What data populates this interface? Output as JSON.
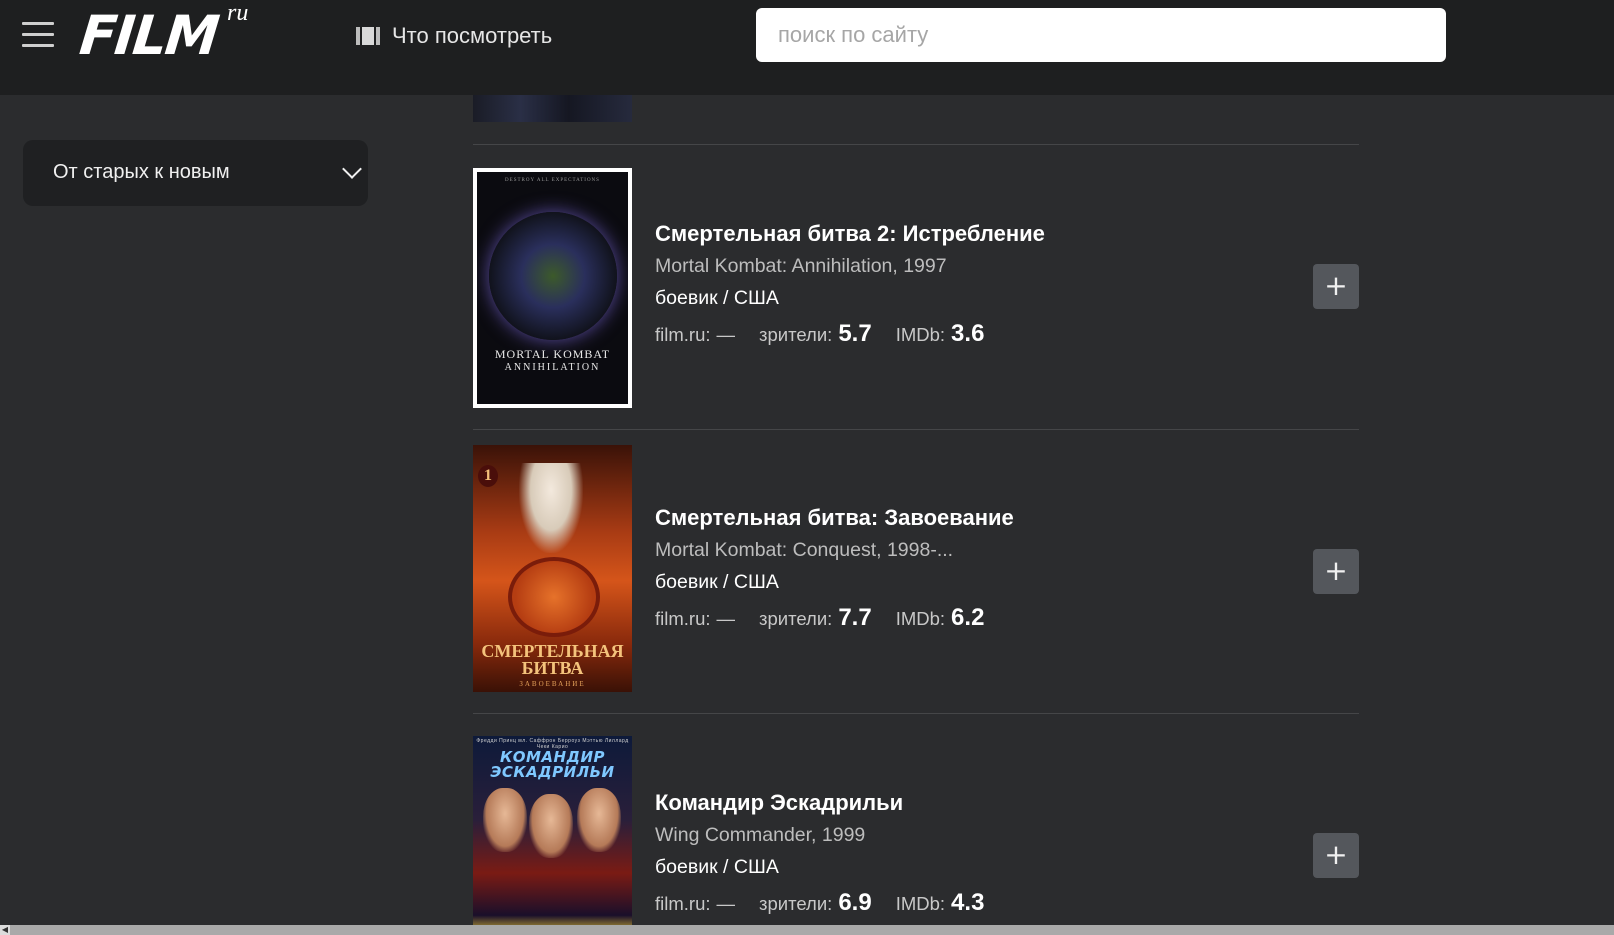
{
  "header": {
    "logo_text": "FILM",
    "logo_sup": "ru",
    "nav_watch": "Что посмотреть",
    "search_placeholder": "поиск по сайту"
  },
  "sort": {
    "selected": "От старых к новым"
  },
  "films": [
    {
      "title": "Смертельная битва 2: Истребление",
      "original": "Mortal Kombat: Annihilation, 1997",
      "genre": "боевик / США",
      "filmru_label": "film.ru:",
      "filmru_value": "—",
      "viewers_label": "зрители:",
      "viewers_value": "5.7",
      "imdb_label": "IMDb:",
      "imdb_value": "3.6",
      "poster_top": "DESTROY ALL EXPECTATIONS",
      "poster_title": "MORTAL KOMBAT",
      "poster_subtitle": "ANNIHILATION"
    },
    {
      "title": "Смертельная битва: Завоевание",
      "original": "Mortal Kombat: Conquest, 1998-...",
      "genre": "боевик / США",
      "filmru_label": "film.ru:",
      "filmru_value": "—",
      "viewers_label": "зрители:",
      "viewers_value": "7.7",
      "imdb_label": "IMDb:",
      "imdb_value": "6.2",
      "poster_badge": "1",
      "poster_title": "СМЕРТЕЛЬНАЯ",
      "poster_title2": "БИТВА",
      "poster_subtitle": "ЗАВОЕВАНИЕ"
    },
    {
      "title": "Командир Эскадрильи",
      "original": "Wing Commander, 1999",
      "genre": "боевик / США",
      "filmru_label": "film.ru:",
      "filmru_value": "—",
      "viewers_label": "зрители:",
      "viewers_value": "6.9",
      "imdb_label": "IMDb:",
      "imdb_value": "4.3",
      "poster_names": "Фредди Принц мл.   Саффрон Берроуз   Мэттью Лиллард   Чеки Карио",
      "poster_title": "КОМАНДИР",
      "poster_title2": "ЭСКАДРИЛЬИ"
    }
  ],
  "add_label": "+"
}
